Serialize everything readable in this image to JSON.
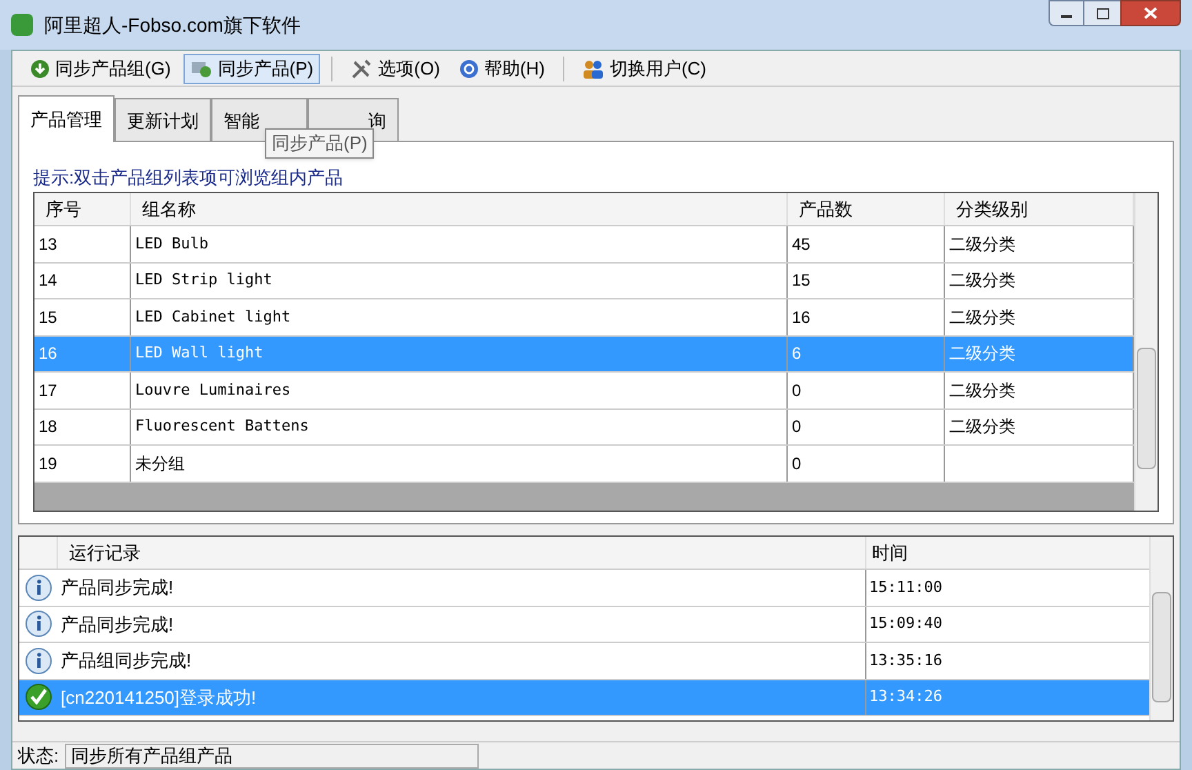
{
  "window": {
    "title": "阿里超人-Fobso.com旗下软件"
  },
  "toolbar": [
    {
      "label": "同步产品组(G)",
      "kind": "download",
      "selected": false
    },
    {
      "label": "同步产品(P)",
      "kind": "sync",
      "selected": true
    },
    {
      "label": "选项(O)",
      "kind": "tools",
      "selected": false
    },
    {
      "label": "帮助(H)",
      "kind": "help",
      "selected": false
    },
    {
      "label": "切换用户(C)",
      "kind": "users",
      "selected": false
    }
  ],
  "tooltip": "同步产品(P)",
  "tabs": [
    {
      "label": "产品管理",
      "selected": true
    },
    {
      "label": "更新计划",
      "selected": false
    },
    {
      "label": "智能",
      "selected": false
    },
    {
      "label": "询",
      "selected": false
    }
  ],
  "hint": "提示:双击产品组列表项可浏览组内产品",
  "groups_table": {
    "columns": [
      "序号",
      "组名称",
      "产品数",
      "分类级别"
    ],
    "rows": [
      {
        "cells": [
          "13",
          "LED Bulb",
          "45",
          "二级分类"
        ],
        "selected": false
      },
      {
        "cells": [
          "14",
          "LED Strip light",
          "15",
          "二级分类"
        ],
        "selected": false
      },
      {
        "cells": [
          "15",
          "LED Cabinet light",
          "16",
          "二级分类"
        ],
        "selected": false
      },
      {
        "cells": [
          "16",
          "LED Wall light",
          "6",
          "二级分类"
        ],
        "selected": true
      },
      {
        "cells": [
          "17",
          "Louvre Luminaires",
          "0",
          "二级分类"
        ],
        "selected": false
      },
      {
        "cells": [
          "18",
          "Fluorescent Battens",
          "0",
          "二级分类"
        ],
        "selected": false
      },
      {
        "cells": [
          "19",
          "未分组",
          "0",
          ""
        ],
        "selected": false
      }
    ]
  },
  "log_table": {
    "columns": [
      "运行记录",
      "时间"
    ],
    "rows": [
      {
        "kind": "info",
        "message": "产品同步完成!",
        "time": "15:11:00",
        "selected": false
      },
      {
        "kind": "info",
        "message": "产品同步完成!",
        "time": "15:09:40",
        "selected": false
      },
      {
        "kind": "info",
        "message": "产品组同步完成!",
        "time": "13:35:16",
        "selected": false
      },
      {
        "kind": "success",
        "message": "[cn220141250]登录成功!",
        "time": "13:34:26",
        "selected": true
      }
    ]
  },
  "status_bar": {
    "label": "状态:",
    "value": "同步所有产品组产品"
  }
}
